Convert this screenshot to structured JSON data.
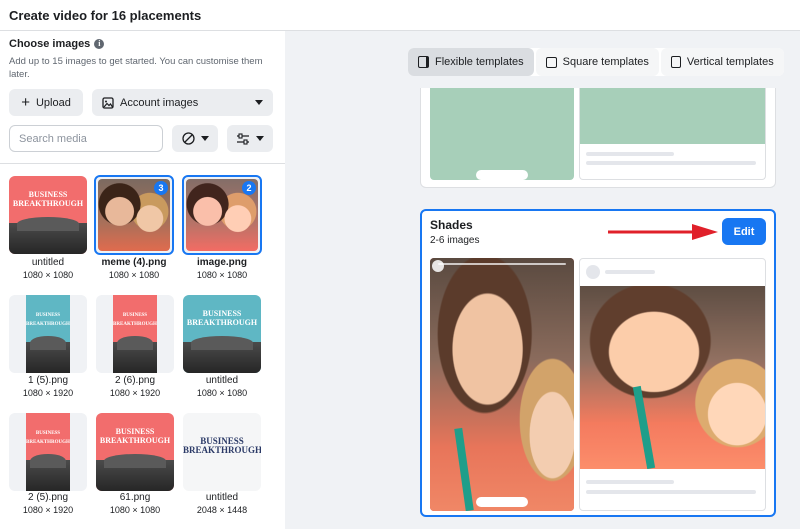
{
  "header": {
    "title": "Create video for 16 placements"
  },
  "left": {
    "choose_label": "Choose images",
    "help_text": "Add up to 15 images to get started. You can customise them later.",
    "upload_label": "Upload",
    "account_label": "Account images",
    "search_placeholder": "Search media"
  },
  "media": [
    {
      "name": "untitled",
      "dims": "1080 × 1080",
      "selected": false
    },
    {
      "name": "meme (4).png",
      "dims": "1080 × 1080",
      "selected": true,
      "badge": "3"
    },
    {
      "name": "image.png",
      "dims": "1080 × 1080",
      "selected": true,
      "badge": "2"
    },
    {
      "name": "1 (5).png",
      "dims": "1080 × 1920",
      "selected": false
    },
    {
      "name": "2 (6).png",
      "dims": "1080 × 1920",
      "selected": false
    },
    {
      "name": "untitled",
      "dims": "1080 × 1080",
      "selected": false
    },
    {
      "name": "2 (5).png",
      "dims": "1080 × 1920",
      "selected": false
    },
    {
      "name": "61.png",
      "dims": "1080 × 1080",
      "selected": false
    },
    {
      "name": "untitled",
      "dims": "2048 × 1448",
      "selected": false
    }
  ],
  "poster_text": "BUSINESS BREAKTHROUGH",
  "tabs": [
    {
      "label": "Flexible templates",
      "active": true
    },
    {
      "label": "Square templates",
      "active": false
    },
    {
      "label": "Vertical templates",
      "active": false
    }
  ],
  "template": {
    "name": "Shades",
    "sub": "2-6 images",
    "edit_label": "Edit"
  },
  "colors": {
    "accent": "#1877f2",
    "arrow": "#e0202a",
    "mint": "#a7cfb9",
    "coral": "#f26d6d"
  }
}
